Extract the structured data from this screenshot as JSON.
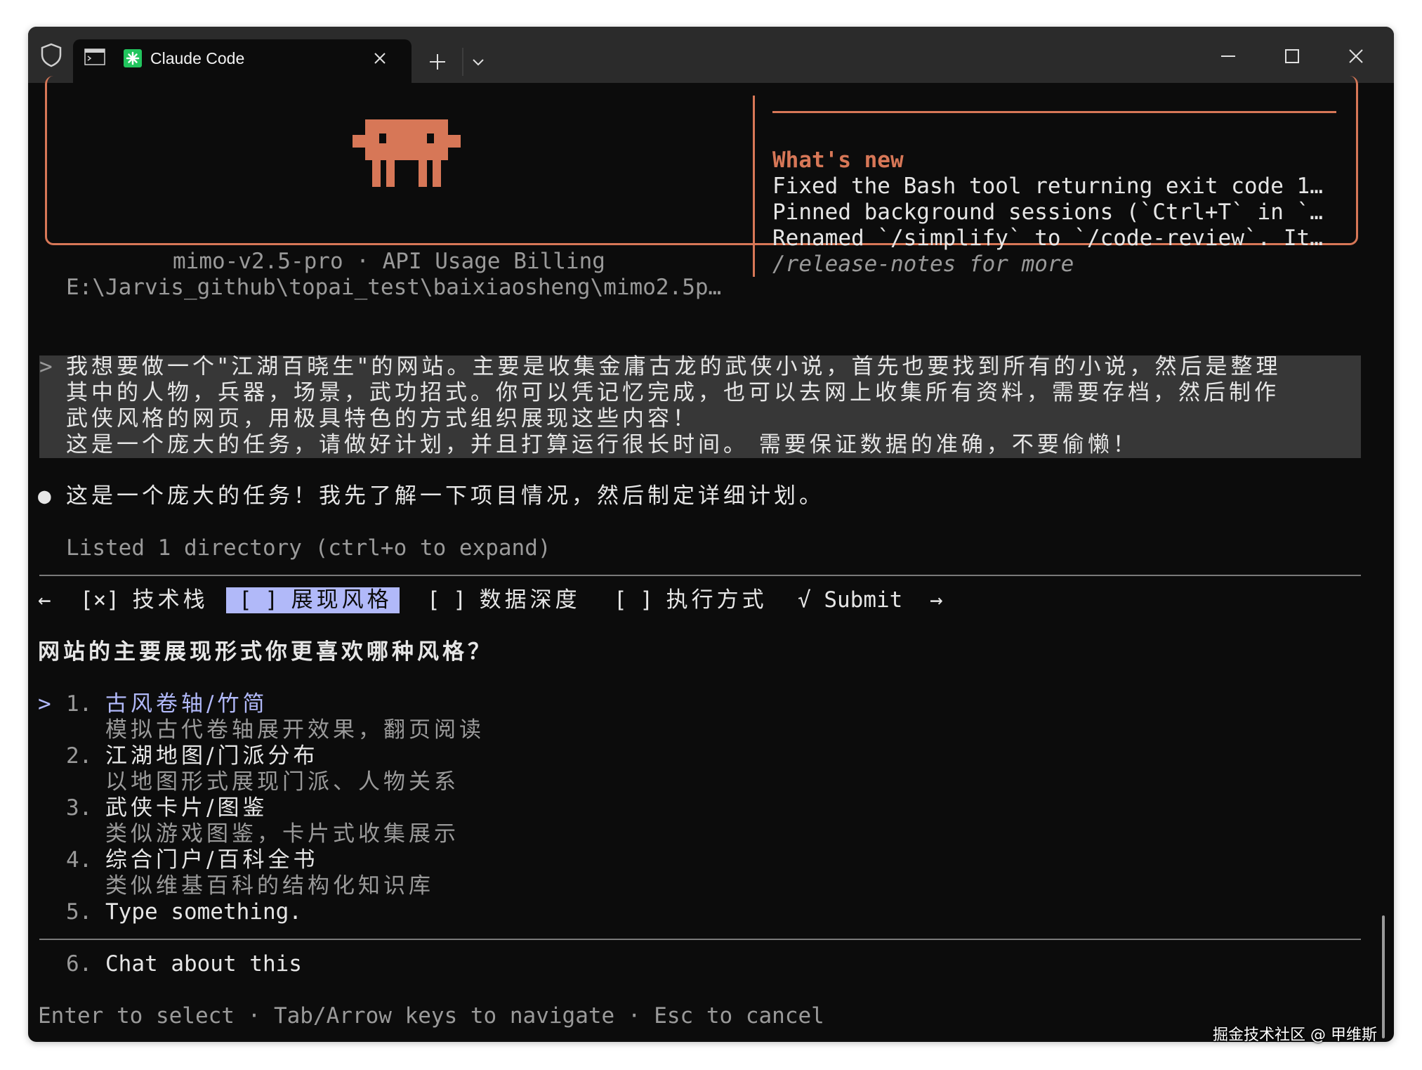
{
  "window": {
    "tab_title": "Claude Code"
  },
  "welcome": {
    "model_line": "mimo-v2.5-pro · API Usage Billing",
    "path_line": "E:\\Jarvis_github\\topai_test\\baixiaosheng\\mimo2.5p…",
    "whats_new_title": "What's new",
    "notes": [
      "Fixed the Bash tool returning exit code 1…",
      "Pinned background sessions (`Ctrl+T` in `…",
      "Renamed `/simplify` to `/code-review`. It…"
    ],
    "release_notes": "/release-notes for more"
  },
  "user_prompt": {
    "marker": ">",
    "lines": [
      "我想要做一个\"江湖百晓生\"的网站。主要是收集金庸古龙的武侠小说，首先也要找到所有的小说，然后是整理",
      "其中的人物，兵器，场景，武功招式。你可以凭记忆完成，也可以去网上收集所有资料，需要存档，然后制作",
      "武侠风格的网页，用极具特色的方式组织展现这些内容！",
      "这是一个庞大的任务，请做好计划，并且打算运行很长时间。 需要保证数据的准确，不要偷懒！"
    ]
  },
  "assistant": {
    "bullet": "●",
    "message": "这是一个庞大的任务！我先了解一下项目情况，然后制定详细计划。",
    "tool_result": "Listed 1 directory (ctrl+o to expand)"
  },
  "question_tabs": {
    "left_arrow": "←",
    "right_arrow": "→",
    "tabs": [
      {
        "check": "[×]",
        "label": "技术栈"
      },
      {
        "check": "[ ]",
        "label": "展现风格"
      },
      {
        "check": "[ ]",
        "label": "数据深度"
      },
      {
        "check": "[ ]",
        "label": "执行方式"
      }
    ],
    "submit_check": "√",
    "submit_label": "Submit"
  },
  "question": {
    "text": "网站的主要展现形式你更喜欢哪种风格？",
    "cursor": ">",
    "options": [
      {
        "num": "1.",
        "label": "古风卷轴/竹简",
        "desc": "模拟古代卷轴展开效果，翻页阅读"
      },
      {
        "num": "2.",
        "label": "江湖地图/门派分布",
        "desc": "以地图形式展现门派、人物关系"
      },
      {
        "num": "3.",
        "label": "武侠卡片/图鉴",
        "desc": "类似游戏图鉴，卡片式收集展示"
      },
      {
        "num": "4.",
        "label": "综合门户/百科全书",
        "desc": "类似维基百科的结构化知识库"
      },
      {
        "num": "5.",
        "label": "Type something."
      }
    ],
    "chat_option": {
      "num": "6.",
      "label": "Chat about this"
    },
    "footer": "Enter to select · Tab/Arrow keys to navigate · Esc to cancel"
  },
  "watermark": "掘金技术社区 @ 甲维斯",
  "colors": {
    "terminal_bg": "#0c0c0c",
    "accent_orange": "#d77757",
    "selection_purple": "#b1b9f9",
    "prompt_bg": "#373737"
  }
}
